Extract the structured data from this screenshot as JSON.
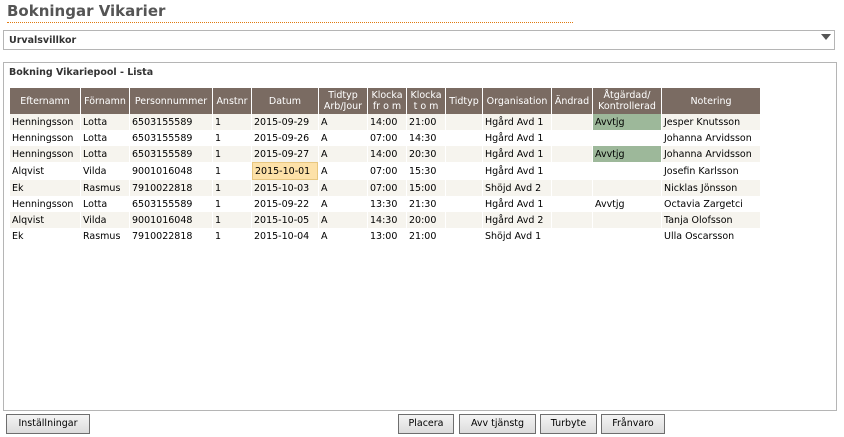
{
  "header": {
    "title": "Bokningar Vikarier"
  },
  "filter": {
    "label": "Urvalsvillkor"
  },
  "panel": {
    "title": "Bokning Vikariepool - Lista"
  },
  "table": {
    "columns": [
      "Efternamn",
      "Förnamn",
      "Personnummer",
      "Anstnr",
      "Datum",
      "Tidtyp Arb/Jour",
      "Klocka fr o m",
      "Klocka t o m",
      "Tidtyp",
      "Organisation",
      "Ändrad",
      "Åtgärdad/ Kontrollerad",
      "Notering"
    ],
    "rows": [
      [
        "Henningsson",
        "Lotta",
        "6503155589",
        "1",
        "2015-09-29",
        "A",
        "14:00",
        "21:00",
        "",
        "Hgård Avd 1",
        "",
        "Avvtjg",
        "Jesper Knutsson"
      ],
      [
        "Henningsson",
        "Lotta",
        "6503155589",
        "1",
        "2015-09-26",
        "A",
        "07:00",
        "14:30",
        "",
        "Hgård Avd 1",
        "",
        "",
        "Johanna Arvidsson"
      ],
      [
        "Henningsson",
        "Lotta",
        "6503155589",
        "1",
        "2015-09-27",
        "A",
        "14:00",
        "20:30",
        "",
        "Hgård Avd 1",
        "",
        "Avvtjg",
        "Johanna Arvidsson"
      ],
      [
        "Alqvist",
        "Vilda",
        "9001016048",
        "1",
        "2015-10-01",
        "A",
        "07:00",
        "15:30",
        "",
        "Hgård Avd 1",
        "",
        "",
        "Josefin Karlsson"
      ],
      [
        "Ek",
        "Rasmus",
        "7910022818",
        "1",
        "2015-10-03",
        "A",
        "07:00",
        "15:00",
        "",
        "Shöjd Avd 2",
        "",
        "",
        "Nicklas Jönsson"
      ],
      [
        "Henningsson",
        "Lotta",
        "6503155589",
        "1",
        "2015-09-22",
        "A",
        "13:30",
        "21:30",
        "",
        "Hgård Avd 1",
        "",
        "Avvtjg",
        "Octavia Zargetci"
      ],
      [
        "Alqvist",
        "Vilda",
        "9001016048",
        "1",
        "2015-10-05",
        "A",
        "14:30",
        "20:00",
        "",
        "Hgård Avd 2",
        "",
        "",
        "Tanja Olofsson"
      ],
      [
        "Ek",
        "Rasmus",
        "7910022818",
        "1",
        "2015-10-04",
        "A",
        "13:00",
        "21:00",
        "",
        "Shöjd Avd 1",
        "",
        "",
        "Ulla Oscarsson"
      ]
    ],
    "highlighted_status_rows": [
      0,
      2
    ],
    "highlighted_date_row": 3
  },
  "buttons": {
    "settings": "Inställningar",
    "place": "Placera",
    "avv": "Avv tjänstg",
    "swap": "Turbyte",
    "absence": "Frånvaro"
  },
  "colors": {
    "title": "#555555",
    "header_bg": "#7a6b62",
    "status_highlight": "#9db89a",
    "date_highlight": "#fde1a8",
    "rule": "#e07a10"
  }
}
